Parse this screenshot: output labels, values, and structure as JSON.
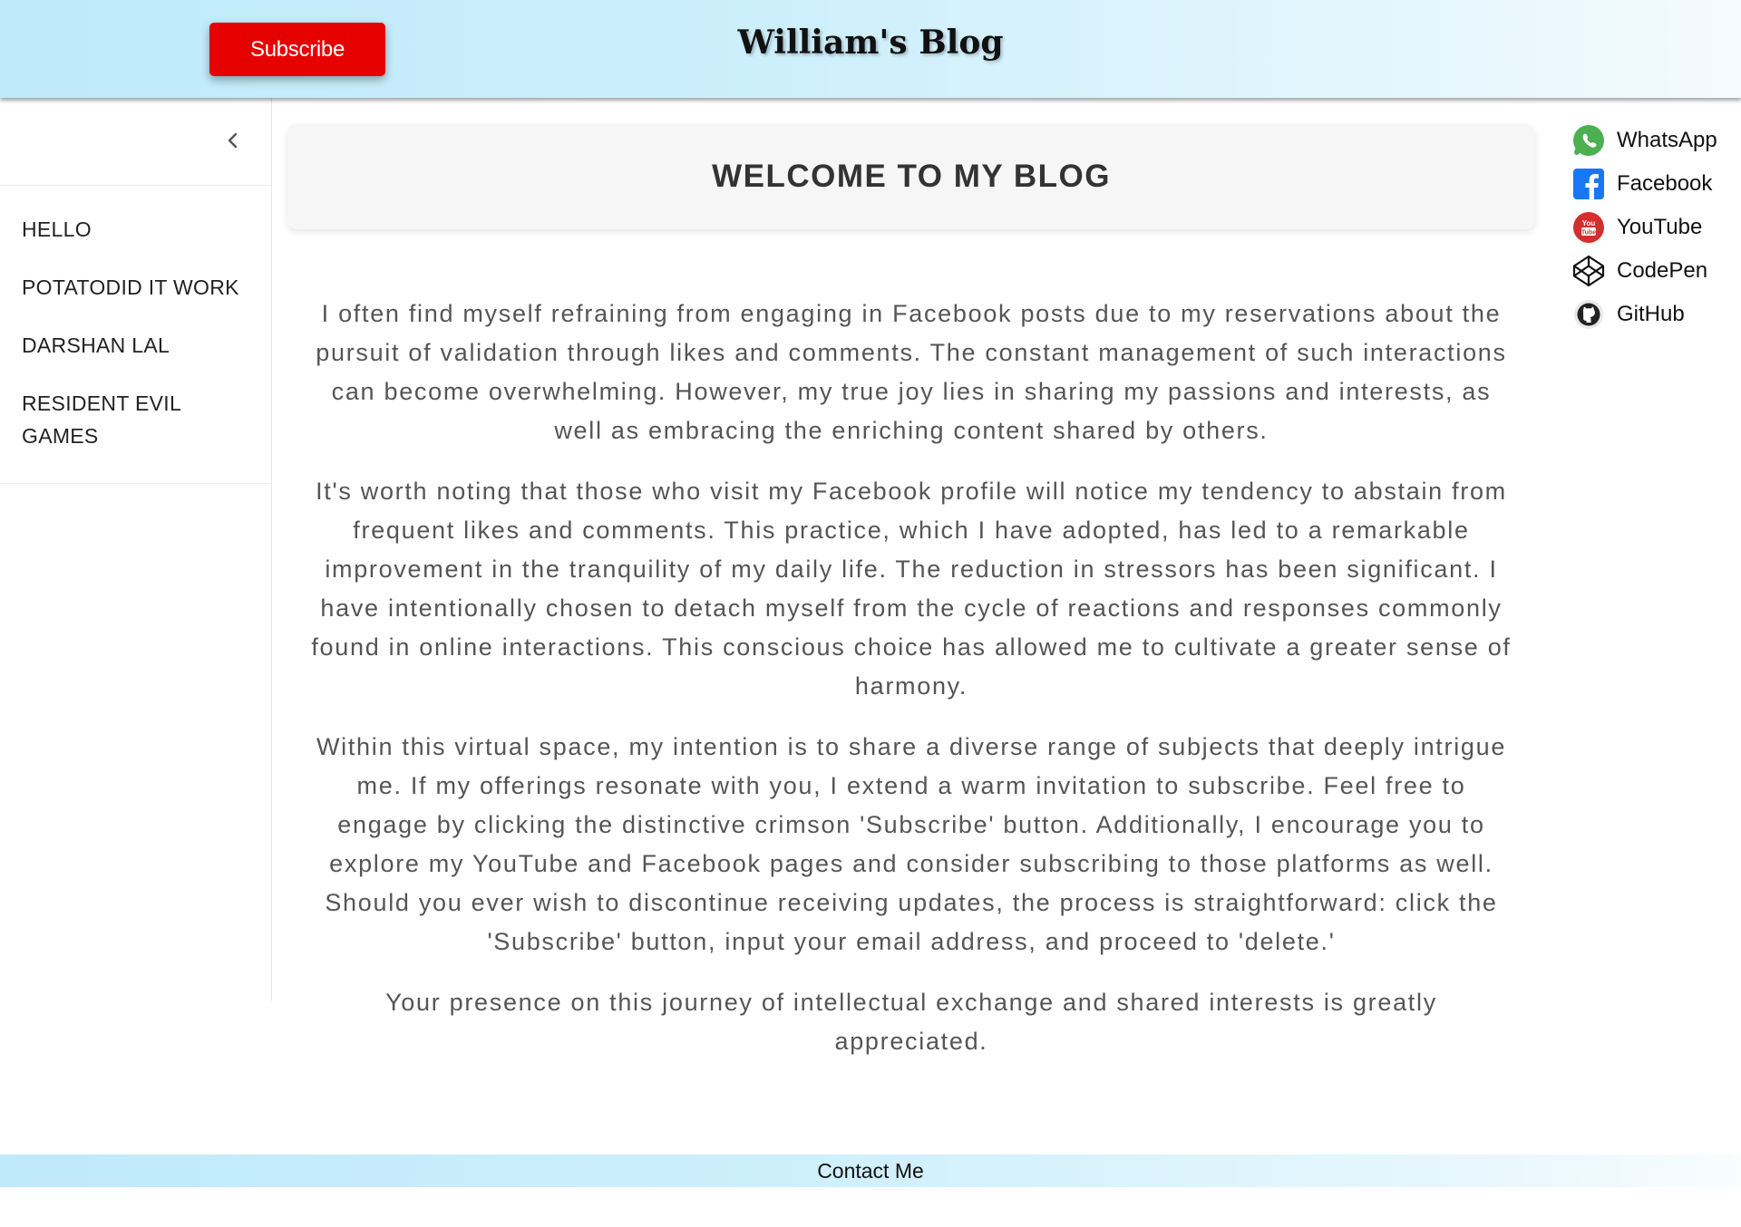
{
  "header": {
    "subscribe_label": "Subscribe",
    "title": "William's Blog"
  },
  "sidebar": {
    "items": [
      {
        "label": "HELLO"
      },
      {
        "label": "POTATODID IT WORK"
      },
      {
        "label": "DARSHAN LAL"
      },
      {
        "label": "RESIDENT EVIL GAMES"
      }
    ]
  },
  "main": {
    "heading": "WELCOME TO MY BLOG",
    "paragraphs": [
      "I often find myself refraining from engaging in Facebook posts due to my reservations about the pursuit of validation through likes and comments. The constant management of such interactions can become overwhelming. However, my true joy lies in sharing my passions and interests, as well as embracing the enriching content shared by others.",
      "It's worth noting that those who visit my Facebook profile will notice my tendency to abstain from frequent likes and comments. This practice, which I have adopted, has led to a remarkable improvement in the tranquility of my daily life. The reduction in stressors has been significant. I have intentionally chosen to detach myself from the cycle of reactions and responses commonly found in online interactions. This conscious choice has allowed me to cultivate a greater sense of harmony.",
      "Within this virtual space, my intention is to share a diverse range of subjects that deeply intrigue me. If my offerings resonate with you, I extend a warm invitation to subscribe. Feel free to engage by clicking the distinctive crimson 'Subscribe' button. Additionally, I encourage you to explore my YouTube and Facebook pages and consider subscribing to those platforms as well. Should you ever wish to discontinue receiving updates, the process is straightforward: click the 'Subscribe' button, input your email address, and proceed to 'delete.'",
      "Your presence on this journey of intellectual exchange and shared interests is greatly appreciated."
    ]
  },
  "social": [
    {
      "label": "WhatsApp",
      "icon": "whatsapp-icon",
      "color": "#4caf50"
    },
    {
      "label": "Facebook",
      "icon": "facebook-icon",
      "color": "#1877f2"
    },
    {
      "label": "YouTube",
      "icon": "youtube-icon",
      "color": "#d32f2f"
    },
    {
      "label": "CodePen",
      "icon": "codepen-icon",
      "color": "#111111"
    },
    {
      "label": "GitHub",
      "icon": "github-icon",
      "color": "#222222"
    }
  ],
  "footer": {
    "contact_label": "Contact Me"
  },
  "colors": {
    "subscribe": "#e60000",
    "header_gradient_start": "#bfeafa",
    "header_gradient_end": "#f4fbfe"
  }
}
